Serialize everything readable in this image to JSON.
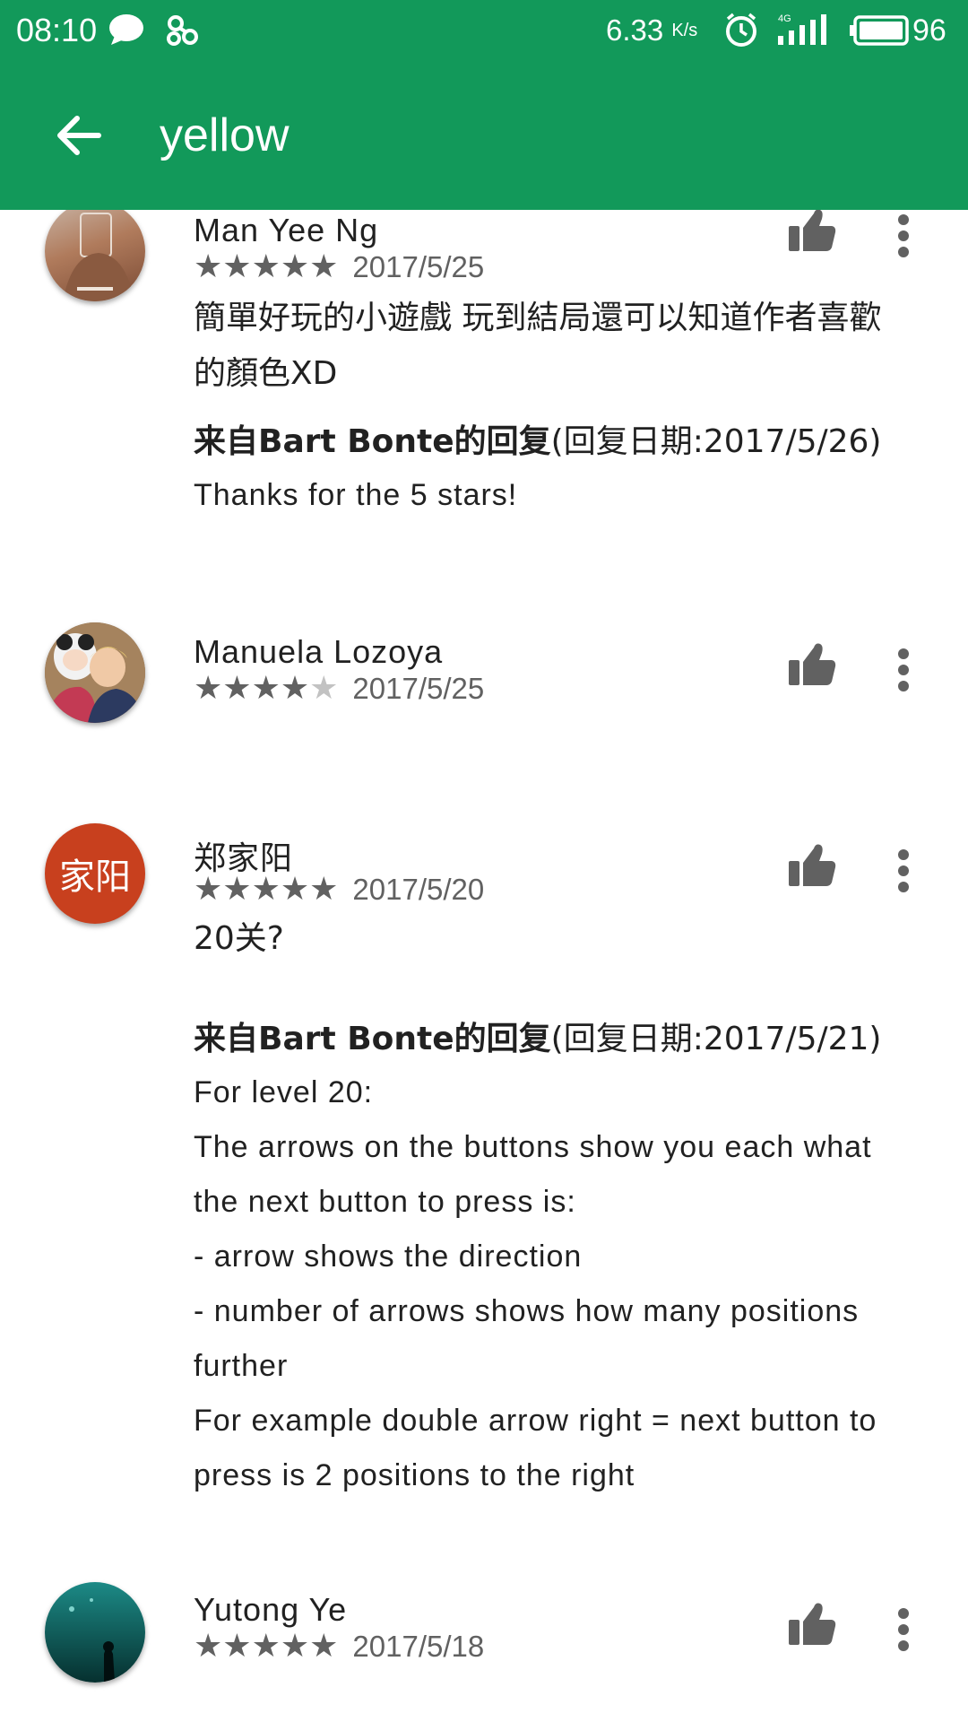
{
  "status_bar": {
    "time": "08:10",
    "left_icons": [
      "chat-bubble-icon",
      "app-icon"
    ],
    "network_speed": "6.33",
    "network_speed_unit": "K/s",
    "right_icons": [
      "alarm-icon",
      "signal-4g-icon",
      "battery-icon"
    ],
    "network_type": "4G",
    "battery": "96",
    "background": "#12995a"
  },
  "app_bar": {
    "search_query": "yellow",
    "back_icon": "arrow-back-icon",
    "background": "#12995a"
  },
  "reviews": [
    {
      "author": "Man Yee Ng",
      "rating": 5,
      "date": "2017/5/25",
      "text": "簡單好玩的小遊戲 玩到結局還可以知道作者喜歡的顏色XD",
      "reply": {
        "from": "来自Bart Bonte的回复",
        "date_label": "(回复日期:2017/5/26)",
        "lines": [
          "Thanks for the 5 stars!"
        ]
      }
    },
    {
      "author": "Manuela Lozoya",
      "rating": 4,
      "date": "2017/5/25"
    },
    {
      "author": "郑家阳",
      "avatar_text": "家阳",
      "avatar_color": "#c8401e",
      "rating": 5,
      "date": "2017/5/20",
      "text": "20关?",
      "reply": {
        "from": "来自Bart Bonte的回复",
        "date_label": "(回复日期:2017/5/21)",
        "lines": [
          "For level 20:",
          "The arrows on the buttons show you each what",
          "the next button to press is:",
          "- arrow shows the direction",
          "- number of arrows shows how many positions",
          "further",
          "For example double arrow right = next button to",
          "press is 2 positions to the right"
        ]
      }
    },
    {
      "author": "Yutong Ye",
      "rating": 5,
      "date": "2017/5/18"
    }
  ],
  "icons": {
    "like": "thumbs-up-icon",
    "more": "more-vert-icon",
    "star_filled": "★",
    "star_empty": "★"
  }
}
